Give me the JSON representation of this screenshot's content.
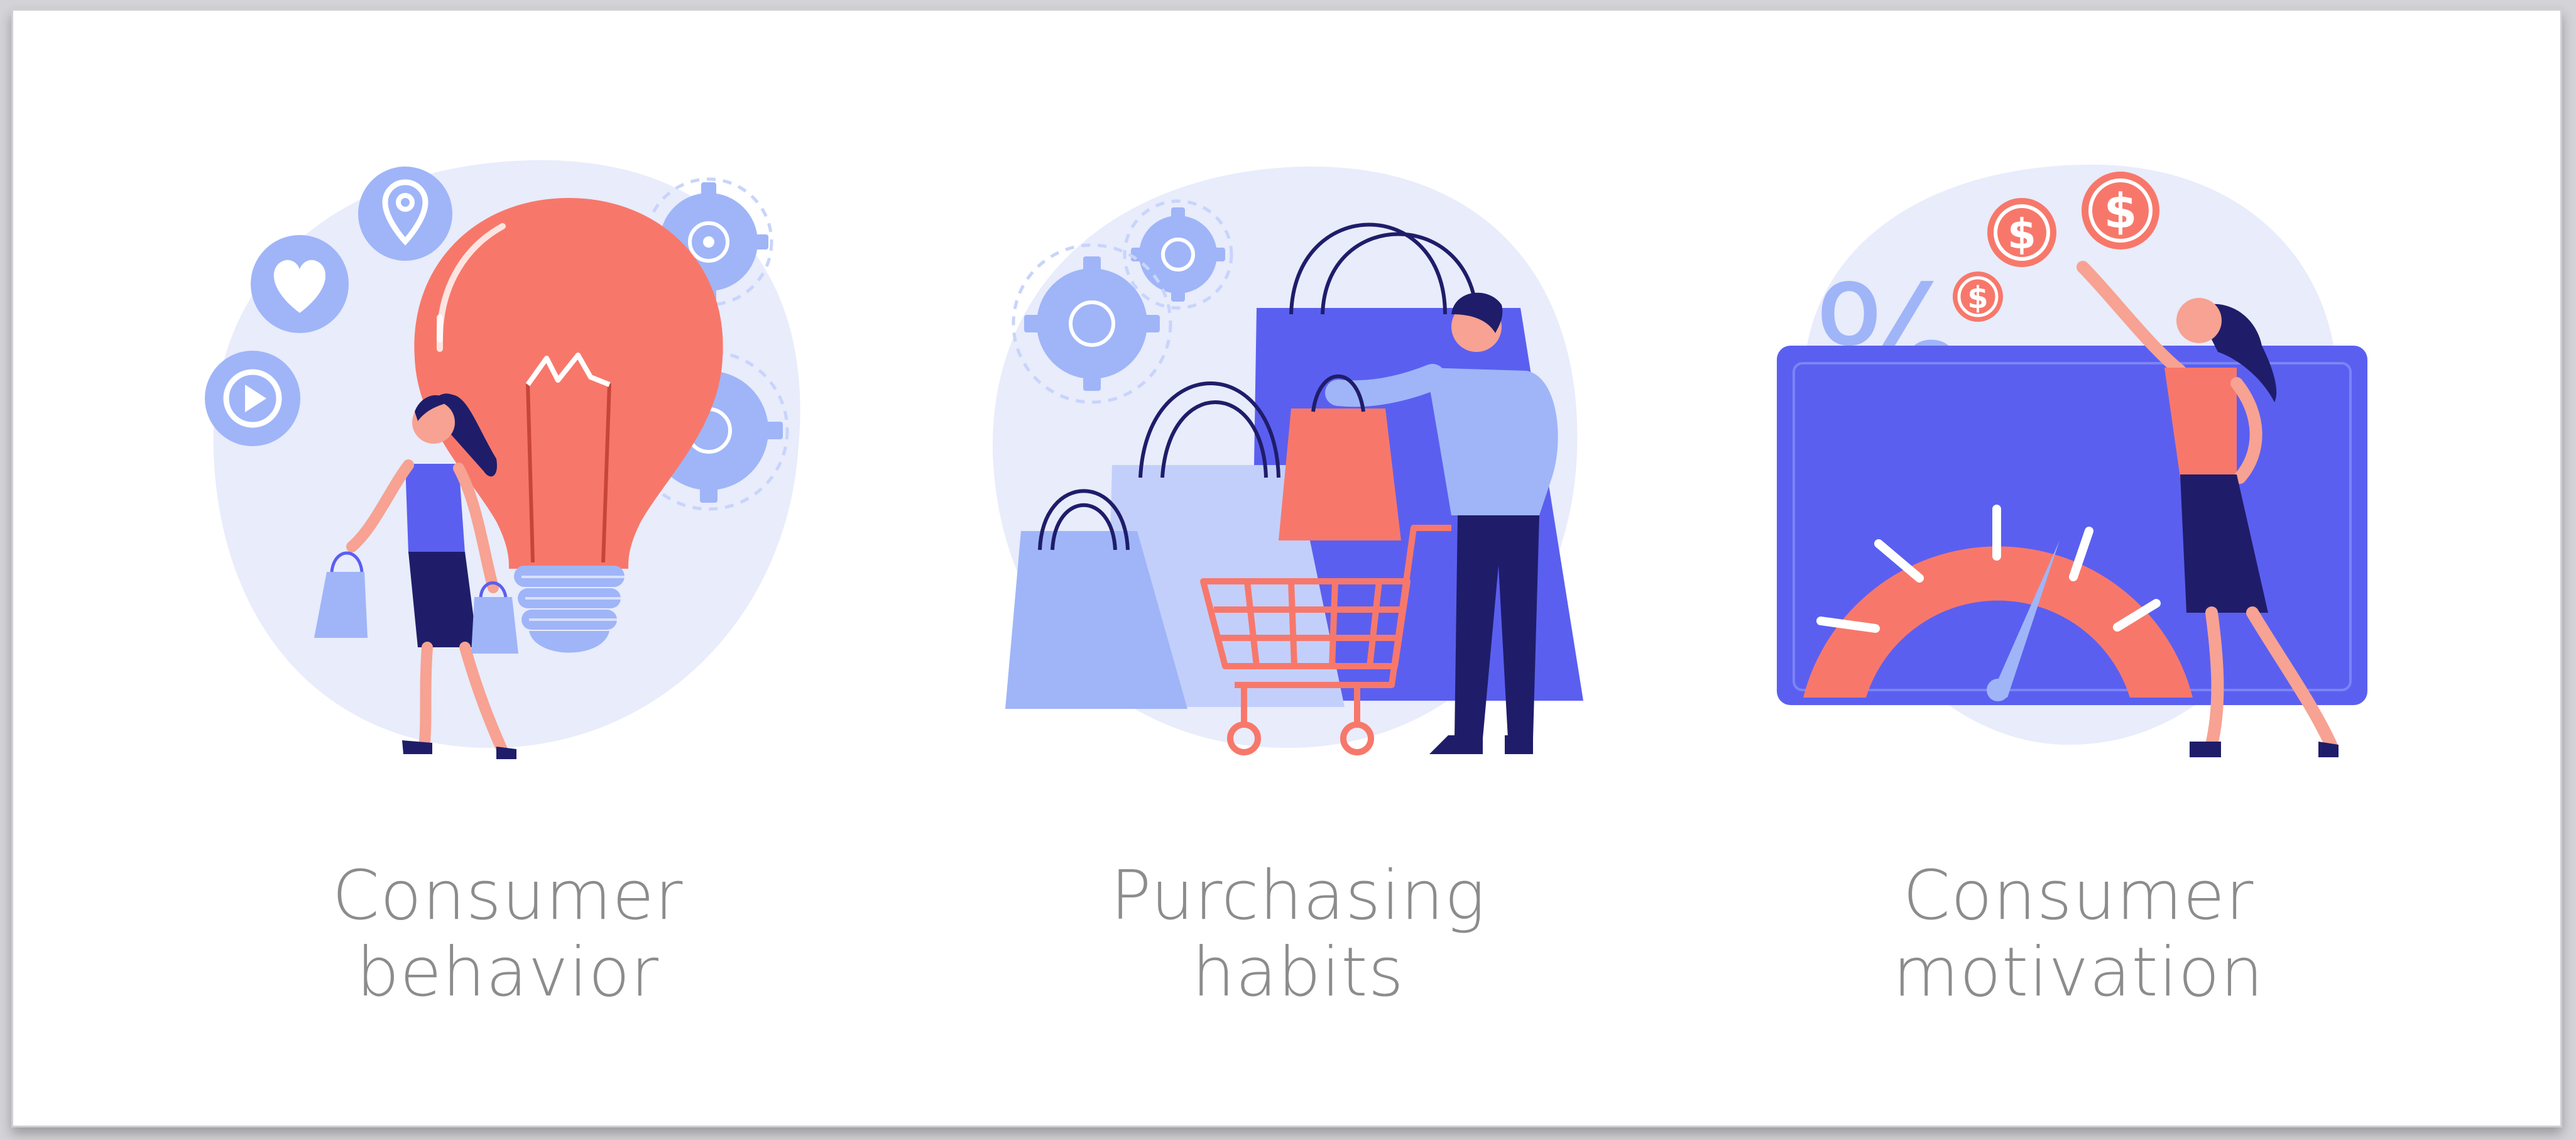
{
  "panels": [
    {
      "caption_line1": "Consumer",
      "caption_line2": "behavior",
      "icon": "lightbulb-icon"
    },
    {
      "caption_line1": "Purchasing",
      "caption_line2": "habits",
      "icon": "shopping-cart-icon"
    },
    {
      "caption_line1": "Consumer",
      "caption_line2": "motivation",
      "icon": "gauge-icon"
    }
  ],
  "badges": {
    "dollar_symbol": "$",
    "percent_symbol": "%"
  },
  "colors": {
    "blob": "#e8ecfb",
    "coral": "#f7786b",
    "light_blue": "#9fb5f8",
    "blue": "#5b5ff0",
    "navy": "#1f1d6a",
    "caption": "#8c8c8c"
  }
}
